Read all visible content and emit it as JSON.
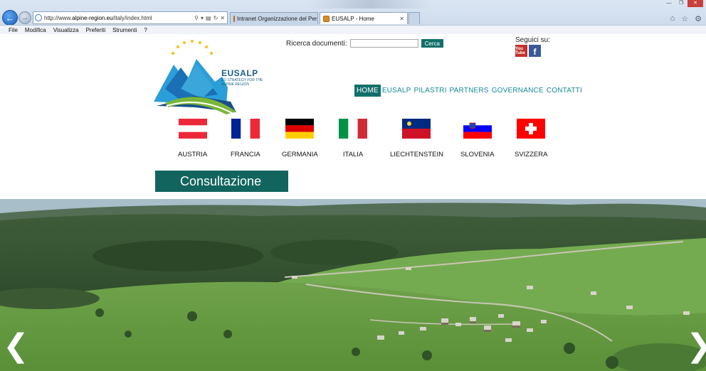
{
  "browser": {
    "url_prefix": "http://www.",
    "url_domain": "alpine-region.eu",
    "url_path": "/italy/index.html",
    "tabs": [
      {
        "label": "Intranet Organizzazione del Per..."
      },
      {
        "label": "EUSALP - Home"
      }
    ],
    "menu": [
      "File",
      "Modifica",
      "Visualizza",
      "Preferiti",
      "Strumenti",
      "?"
    ]
  },
  "logo": {
    "brand": "EUSALP",
    "tagline": "EU STRATEGY FOR THE ALPINE REGION"
  },
  "search": {
    "label": "Ricerca documenti:",
    "value": "",
    "button": "Cerca"
  },
  "social": {
    "label": "Seguici su:",
    "youtube_text": "You Tube",
    "facebook_text": "f"
  },
  "nav": [
    {
      "label": "HOME",
      "active": true
    },
    {
      "label": "EUSALP"
    },
    {
      "label": "PILASTRI"
    },
    {
      "label": "PARTNERS"
    },
    {
      "label": "GOVERNANCE"
    },
    {
      "label": "CONTATTI"
    }
  ],
  "countries": [
    {
      "label": "AUSTRIA",
      "icon": "austria-flag-icon"
    },
    {
      "label": "FRANCIA",
      "icon": "france-flag-icon"
    },
    {
      "label": "GERMANIA",
      "icon": "germany-flag-icon"
    },
    {
      "label": "ITALIA",
      "icon": "italy-flag-icon"
    },
    {
      "label": "LIECHTENSTEIN",
      "icon": "liechtenstein-flag-icon"
    },
    {
      "label": "SLOVENIA",
      "icon": "slovenia-flag-icon"
    },
    {
      "label": "SVIZZERA",
      "icon": "switzerland-flag-icon"
    }
  ],
  "cta": {
    "label": "Consultazione"
  },
  "colors": {
    "accent": "#12706a",
    "nav_text": "#17899a",
    "logo_blue": "#1a5f8a"
  },
  "hero": {
    "icon_prev": "chevron-left-icon",
    "icon_next": "chevron-right-icon"
  }
}
